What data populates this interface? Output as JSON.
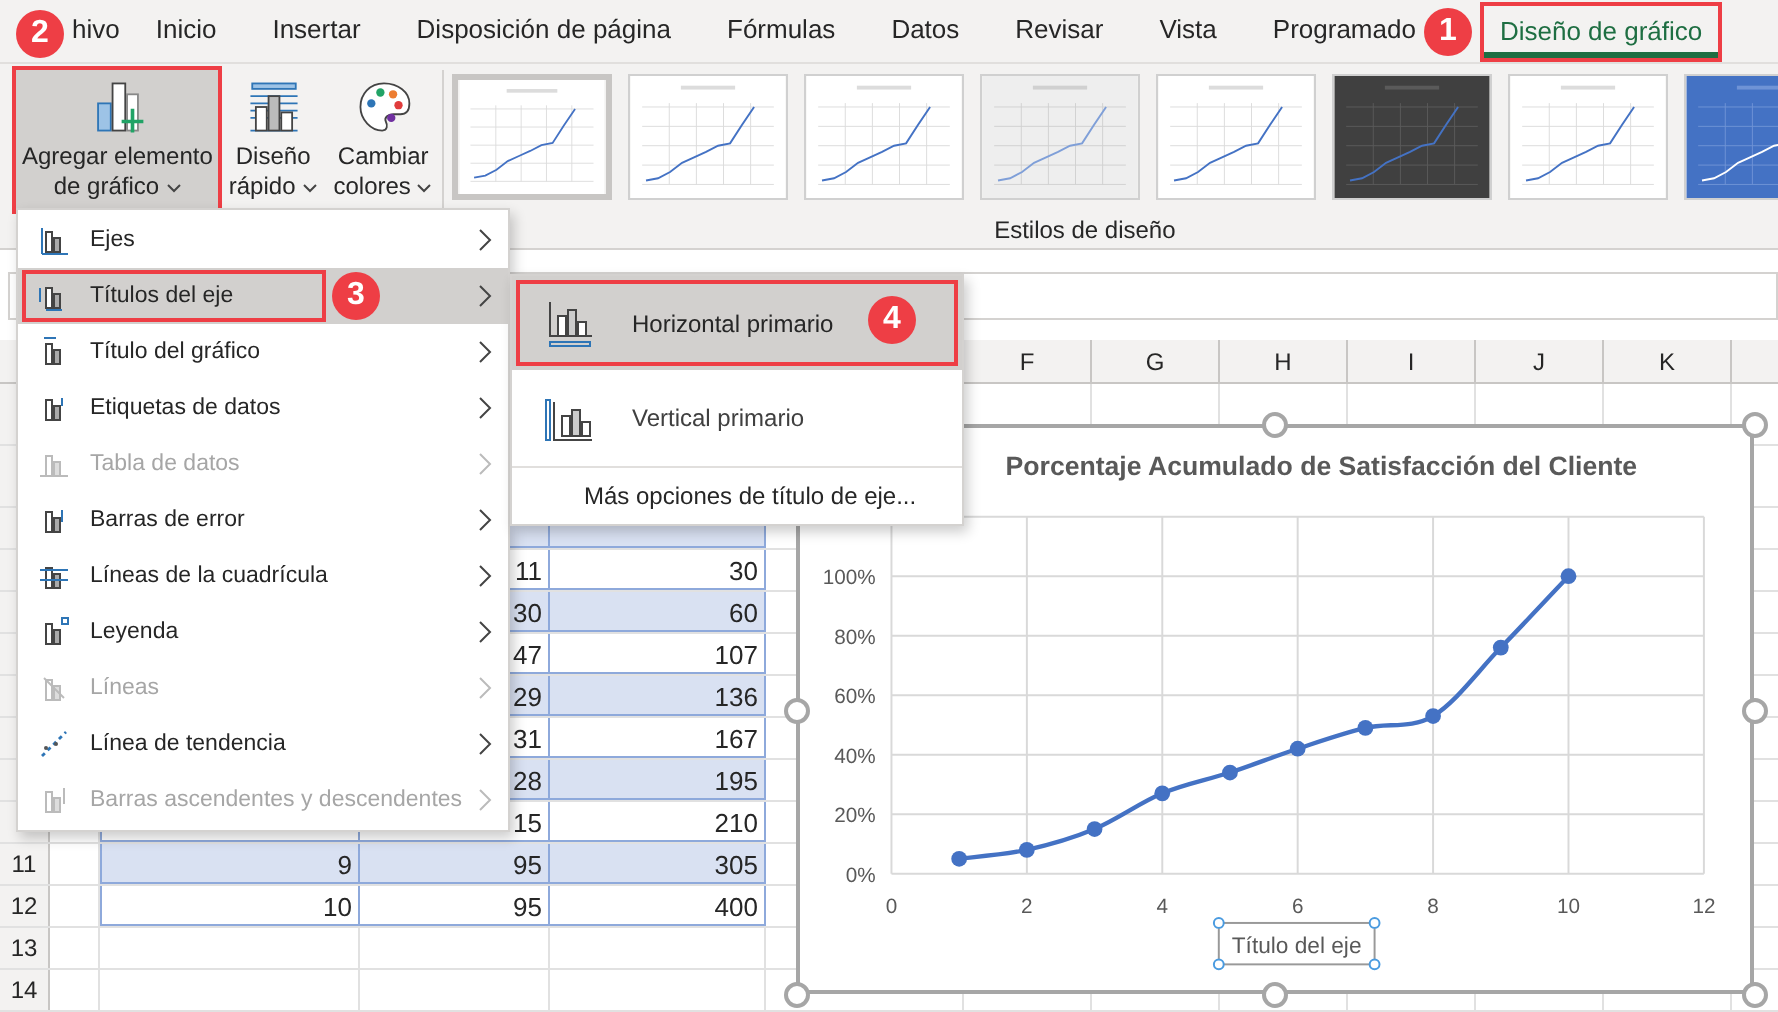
{
  "tabs": [
    {
      "label": "hivo",
      "selected": false,
      "annotated": false
    },
    {
      "label": "Inicio",
      "selected": false,
      "annotated": false
    },
    {
      "label": "Insertar",
      "selected": false,
      "annotated": false
    },
    {
      "label": "Disposición de página",
      "selected": false,
      "annotated": false
    },
    {
      "label": "Fórmulas",
      "selected": false,
      "annotated": false
    },
    {
      "label": "Datos",
      "selected": false,
      "annotated": false
    },
    {
      "label": "Revisar",
      "selected": false,
      "annotated": false
    },
    {
      "label": "Vista",
      "selected": false,
      "annotated": false
    },
    {
      "label": "Programado",
      "selected": false,
      "annotated": false
    },
    {
      "label": "Diseño de gráfico",
      "selected": true,
      "annotated": true
    }
  ],
  "ribbon": {
    "buttons": [
      {
        "lines": [
          "Agregar elemento",
          "de gráfico"
        ],
        "pressed": true,
        "annotated": true
      },
      {
        "lines": [
          "Diseño",
          "rápido"
        ],
        "pressed": false,
        "annotated": false
      },
      {
        "lines": [
          "Cambiar",
          "colores"
        ],
        "pressed": false,
        "annotated": false
      }
    ],
    "styles": [
      {
        "kind": "plain",
        "selected": true
      },
      {
        "kind": "plain",
        "selected": false
      },
      {
        "kind": "plain",
        "selected": false
      },
      {
        "kind": "shaded",
        "selected": false
      },
      {
        "kind": "plain",
        "selected": false
      },
      {
        "kind": "dark",
        "selected": false
      },
      {
        "kind": "plain",
        "selected": false
      },
      {
        "kind": "blue",
        "selected": false
      }
    ],
    "group_label": "Estilos de diseño"
  },
  "menu": {
    "items": [
      {
        "label": "Ejes",
        "disabled": false,
        "selected": false,
        "annotated": false
      },
      {
        "label": "Títulos del eje",
        "disabled": false,
        "selected": true,
        "annotated": true
      },
      {
        "label": "Título del gráfico",
        "disabled": false,
        "selected": false,
        "annotated": false
      },
      {
        "label": "Etiquetas de datos",
        "disabled": false,
        "selected": false,
        "annotated": false
      },
      {
        "label": "Tabla de datos",
        "disabled": true,
        "selected": false,
        "annotated": false
      },
      {
        "label": "Barras de error",
        "disabled": false,
        "selected": false,
        "annotated": false
      },
      {
        "label": "Líneas de la cuadrícula",
        "disabled": false,
        "selected": false,
        "annotated": false
      },
      {
        "label": "Leyenda",
        "disabled": false,
        "selected": false,
        "annotated": false
      },
      {
        "label": "Líneas",
        "disabled": true,
        "selected": false,
        "annotated": false
      },
      {
        "label": "Línea de tendencia",
        "disabled": false,
        "selected": false,
        "annotated": false
      },
      {
        "label": "Barras ascendentes y descendentes",
        "disabled": true,
        "selected": false,
        "annotated": false
      }
    ]
  },
  "submenu": {
    "items": [
      {
        "label": "Horizontal primario",
        "selected": true,
        "annotated": true
      },
      {
        "label": "Vertical primario",
        "selected": false,
        "annotated": false
      }
    ],
    "more": "Más opciones de título de eje..."
  },
  "badges": [
    "1",
    "2",
    "3",
    "4"
  ],
  "sheet": {
    "column_headers": [
      "F",
      "G",
      "H",
      "I",
      "J",
      "K"
    ],
    "row_headers": [
      "11",
      "12",
      "13",
      "14"
    ],
    "rows": [
      {
        "values": [
          "11",
          "30"
        ]
      },
      {
        "values": [
          "30",
          "60"
        ]
      },
      {
        "values": [
          "47",
          "107"
        ]
      },
      {
        "values": [
          "29",
          "136"
        ]
      },
      {
        "values": [
          "31",
          "167"
        ]
      },
      {
        "values": [
          "28",
          "195"
        ]
      },
      {
        "values": [
          "15",
          "210"
        ]
      },
      {
        "values": [
          "9",
          "95",
          "305"
        ]
      },
      {
        "values": [
          "10",
          "95",
          "400"
        ]
      }
    ]
  },
  "chart": {
    "selected": true,
    "axis_title": "Título del eje",
    "chart_data": {
      "type": "line",
      "title": "Porcentaje Acumulado de Satisfacción del Cliente",
      "x": [
        1,
        2,
        3,
        4,
        5,
        6,
        7,
        8,
        9,
        10
      ],
      "series": [
        {
          "color": "#4472c4",
          "values": [
            0.05,
            0.08,
            0.15,
            0.27,
            0.34,
            0.42,
            0.49,
            0.53,
            0.76,
            1.0
          ]
        }
      ],
      "grid": true,
      "marker": true,
      "xlim": [
        0,
        12
      ],
      "ylim": [
        0,
        1.2
      ],
      "xticks": [
        0,
        2,
        4,
        6,
        8,
        10,
        12
      ],
      "yticks": [
        {
          "value": 0,
          "label": "0%"
        },
        {
          "value": 0.2,
          "label": "20%"
        },
        {
          "value": 0.4,
          "label": "40%"
        },
        {
          "value": 0.6,
          "label": "60%"
        },
        {
          "value": 0.8,
          "label": "80%"
        },
        {
          "value": 1,
          "label": "100%"
        }
      ]
    }
  }
}
